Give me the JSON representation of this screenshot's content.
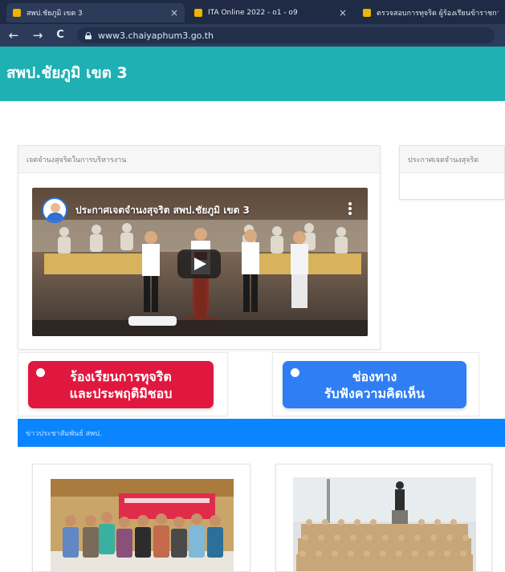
{
  "browser": {
    "tabs": [
      {
        "title": "สพป.ชัยภูมิ เขต 3",
        "active": true,
        "favicon_color": "#f0b400"
      },
      {
        "title": "ITA Online 2022 - o1 - o9",
        "active": false,
        "favicon_color": "#f0b400"
      },
      {
        "title": "ตรวจสอบการทุจริต ผู้ร้องเรียนข้าราชการครู",
        "active": false,
        "favicon_color": "#f0b400"
      }
    ],
    "close_glyph": "×",
    "back_glyph": "←",
    "forward_glyph": "→",
    "reload_glyph": "C",
    "url": "www3.chaiyaphum3.go.th"
  },
  "site": {
    "title": "สพป.ชัยภูมิ เขต 3",
    "header_color": "#1eb0b2"
  },
  "panels": {
    "left_heading": "เจตจำนงสุจริตในการบริหารงาน",
    "right_heading": "ประกาศเจตจำนงสุจริต"
  },
  "video": {
    "title": "ประกาศเจตจำนงสุจริต สพป.ชัยภูมิ เขต 3"
  },
  "buttons": {
    "complaint": {
      "line1": "ร้องเรียนการทุจริต",
      "line2": "และประพฤติมิชอบ",
      "color": "#e0173e"
    },
    "feedback": {
      "line1": "ช่องทาง",
      "line2": "รับฟังความคิดเห็น",
      "color": "#2f7ef3"
    }
  },
  "section": {
    "label": "ข่าวประชาสัมพันธ์ สพป."
  },
  "colors": {
    "section_bar": "#0a85ff",
    "browser_frame": "#1f2a44"
  }
}
